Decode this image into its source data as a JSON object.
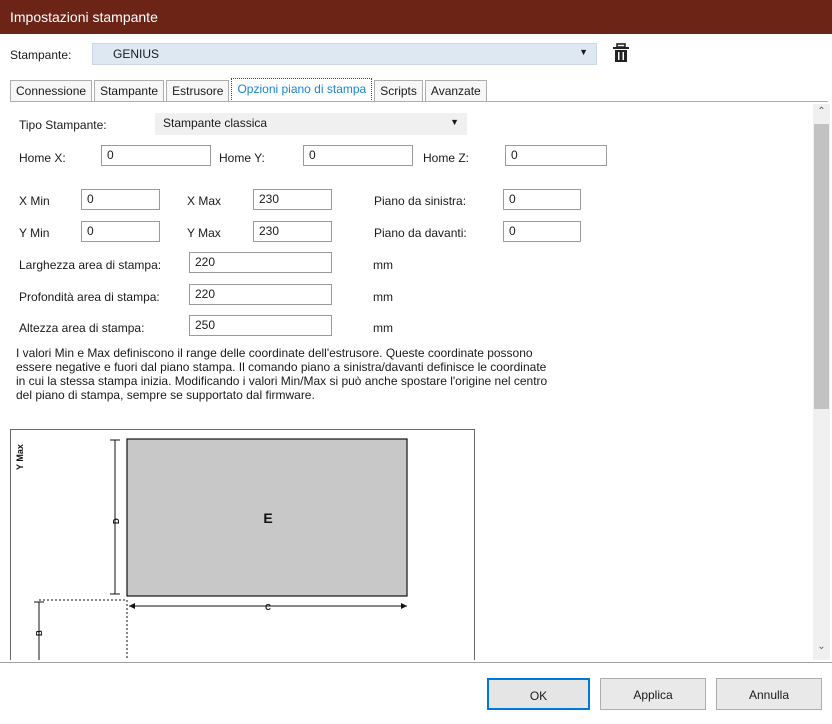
{
  "window": {
    "title": "Impostazioni stampante"
  },
  "printer": {
    "label": "Stampante:",
    "value": "GENIUS"
  },
  "tabs": [
    {
      "label": "Connessione"
    },
    {
      "label": "Stampante"
    },
    {
      "label": "Estrusore"
    },
    {
      "label": "Opzioni piano di stampa",
      "active": true
    },
    {
      "label": "Scripts"
    },
    {
      "label": "Avanzate"
    }
  ],
  "form": {
    "printer_type": {
      "label": "Tipo Stampante:",
      "value": "Stampante classica"
    },
    "home_x": {
      "label": "Home X:",
      "value": "0"
    },
    "home_y": {
      "label": "Home Y:",
      "value": "0"
    },
    "home_z": {
      "label": "Home Z:",
      "value": "0"
    },
    "x_min": {
      "label": "X Min",
      "value": "0"
    },
    "x_max": {
      "label": "X Max",
      "value": "230"
    },
    "y_min": {
      "label": "Y Min",
      "value": "0"
    },
    "y_max": {
      "label": "Y Max",
      "value": "230"
    },
    "bed_left": {
      "label": "Piano da sinistra:",
      "value": "0"
    },
    "bed_front": {
      "label": "Piano da davanti:",
      "value": "0"
    },
    "print_width": {
      "label": "Larghezza area di stampa:",
      "value": "220",
      "unit": "mm"
    },
    "print_depth": {
      "label": "Profondità area di stampa:",
      "value": "220",
      "unit": "mm"
    },
    "print_height": {
      "label": "Altezza area di stampa:",
      "value": "250",
      "unit": "mm"
    }
  },
  "description": [
    "I valori Min e Max definiscono il range delle coordinate dell'estrusore. Queste coordinate possono",
    "essere negative e fuori dal piano stampa. Il comando piano a sinistra/davanti definisce le coordinate",
    "in cui la stessa stampa inizia. Modificando i valori Min/Max si può anche spostare l'origine nel centro",
    "del piano di stampa, sempre se supportato dal firmware."
  ],
  "diagram": {
    "axis_label": "Y Max",
    "area_label": "E",
    "dim_width": "C",
    "dim_depth": "D",
    "dim_front": "B",
    "area_fill": "#c8c8c8"
  },
  "buttons": {
    "ok": "OK",
    "apply": "Applica",
    "cancel": "Annulla"
  },
  "colors": {
    "titlebar": "#6b2416",
    "active_tab_text": "#1a86d1",
    "ok_border": "#0078d7",
    "printer_field": "#dde8f3"
  }
}
